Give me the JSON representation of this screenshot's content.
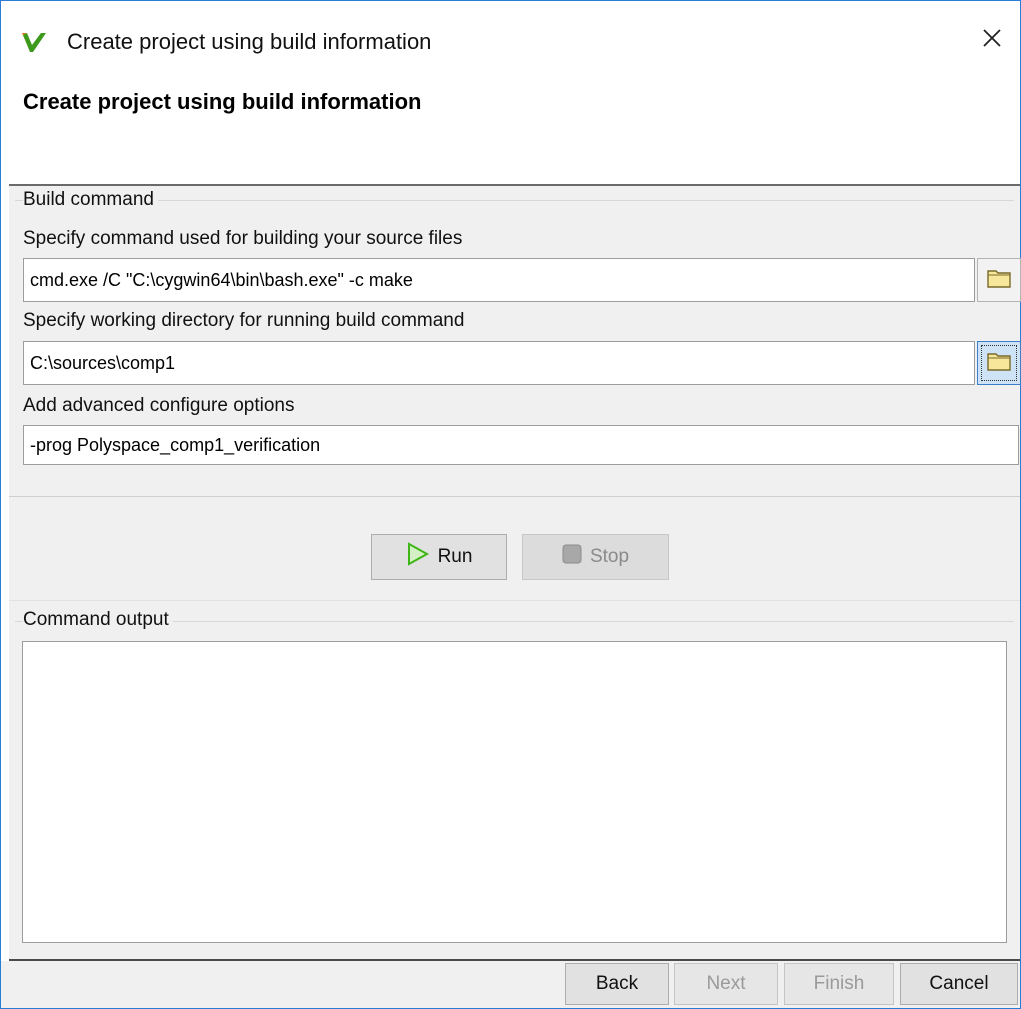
{
  "window": {
    "title": "Create project using build information",
    "header_title": "Create project using build information",
    "app_icon": "polyspace-v-logo-icon",
    "close_icon": "close-icon"
  },
  "build_command": {
    "group_label": "Build command",
    "command_label": "Specify command used for building your source files",
    "command_value": "cmd.exe /C \"C:\\cygwin64\\bin\\bash.exe\" -c make",
    "workdir_label": "Specify working directory for running build command",
    "workdir_value": "C:\\sources\\comp1",
    "advanced_label": "Add advanced configure options",
    "advanced_value": "-prog Polyspace_comp1_verification",
    "browse_icon": "folder-icon"
  },
  "actions": {
    "run_label": "Run",
    "run_icon": "play-icon",
    "stop_label": "Stop",
    "stop_icon": "stop-icon"
  },
  "output": {
    "group_label": "Command output",
    "text": ""
  },
  "footer": {
    "back_label": "Back",
    "next_label": "Next",
    "finish_label": "Finish",
    "cancel_label": "Cancel"
  },
  "colors": {
    "accent_border": "#2a7dd6",
    "play_green": "#3fb618",
    "logo_green": "#3c9a1a",
    "logo_orange": "#e07b1a",
    "folder_yellow": "#f7e79a"
  }
}
